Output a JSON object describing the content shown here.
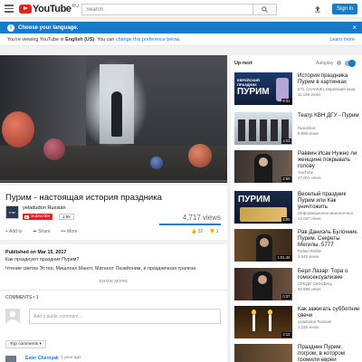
{
  "header": {
    "logo_text": "YouTube",
    "region": "RU",
    "search_placeholder": "Search",
    "signin_label": "Sign in"
  },
  "language_bar": {
    "info_glyph": "i",
    "title": "Choose your language.",
    "close_glyph": "×",
    "notice_prefix": "You're viewing YouTube in ",
    "notice_language": "English (US)",
    "notice_middle": ". You can ",
    "notice_link": "change this preference below",
    "notice_suffix": ".",
    "learn_more": "Learn more"
  },
  "video": {
    "title": "Пурим - настоящая история праздника",
    "channel": "yeladudon Russian",
    "avatar_text": "ישרא",
    "subscribe_label": "Subscribe",
    "subscriber_count": "1.5K",
    "views": "4,717 views",
    "actions": {
      "add": "Add to",
      "share": "Share",
      "more": "More"
    },
    "likes": "32",
    "dislikes": "1",
    "published": "Published on Mar 15, 2017",
    "description_line1": "Как празднуют праздник Пурим?",
    "description_line2": "Чтение свитка Эстер, Мишлоах Манот, Матанот Лаэвйоним, и праздничная трапеза.",
    "show_more": "SHOW MORE"
  },
  "comments": {
    "count_label": "COMMENTS • 1",
    "input_placeholder": "Add a public comment...",
    "sort_label": "Top comments",
    "first_author": "Ester Chernyak",
    "first_time": "1 year ago"
  },
  "sidebar": {
    "up_next": "Up next",
    "autoplay": "Autoplay",
    "autoplay_info": "i",
    "autoplay_on": true,
    "items": [
      {
        "title": "История праздника Пурим в картинках",
        "channel": "ETL CHANNEL Еврейский кана",
        "views": "11,148 views",
        "duration": "6:31",
        "thumb_text": "ЕВРЕЙСКИЙ ПРАЗДНИК\nПУРИМ"
      },
      {
        "title": "Театр КВН ДГУ - Пурим",
        "channel": "fsundobot",
        "views": "8,959 views",
        "duration": "3:03",
        "thumb_text": ""
      },
      {
        "title": "Раввин Исак Нужно ли женщине покрывать голову",
        "channel": "YouTube",
        "views": "47,001 views",
        "duration": "2:50",
        "thumb_text": ""
      },
      {
        "title": "Веселый праздник Пурим или Как уничтожить",
        "channel": "Информационно-аналитическ",
        "views": "13,037 views",
        "duration": "2:00",
        "thumb_text": "ПУРИМ"
      },
      {
        "title": "Рав Даниэль Булочник. Пурим. Секреты Мегилы. 5777",
        "channel": "Rafael Rafilie",
        "views": "3,045 views",
        "duration": "1:01:42",
        "thumb_text": ""
      },
      {
        "title": "Берл Лазар: Тора о гомосексуализме",
        "channel": "СРЕДИ СКОСВАЦ",
        "views": "50,596 views",
        "duration": "0:37",
        "thumb_text": ""
      },
      {
        "title": "Как зажигать субботние свечи",
        "channel": "yeladudon Russian",
        "views": "1,155 views",
        "duration": "3:12",
        "thumb_text": ""
      },
      {
        "title": "Праздник Пурим: погром, в котором громили евреи",
        "channel": "",
        "views": "",
        "duration": "",
        "thumb_text": ""
      }
    ]
  },
  "colors": {
    "accent": "#167ac6",
    "brand_red": "#e62117"
  },
  "icons": [
    "menu-icon",
    "youtube-logo-icon",
    "search-icon",
    "upload-icon",
    "info-icon",
    "close-icon",
    "add-icon",
    "share-icon",
    "more-icon",
    "like-icon",
    "dislike-icon"
  ]
}
